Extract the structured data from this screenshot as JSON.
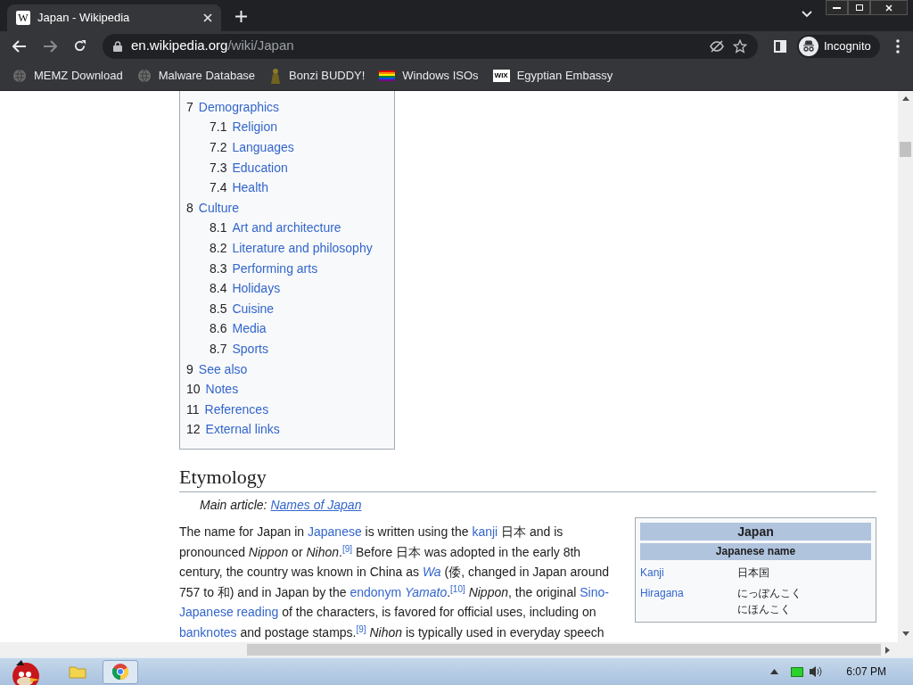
{
  "tab": {
    "favicon": "W",
    "title": "Japan - Wikipedia"
  },
  "address": {
    "host": "en.wikipedia.org",
    "path": "/wiki/Japan"
  },
  "profile": {
    "label": "Incognito"
  },
  "bookmarks": [
    {
      "kind": "globe",
      "label": "MEMZ Download"
    },
    {
      "kind": "globe",
      "label": "Malware Database"
    },
    {
      "kind": "figure",
      "label": "Bonzi BUDDY!"
    },
    {
      "kind": "flag",
      "label": "Windows ISOs"
    },
    {
      "kind": "wix",
      "icon_text": "WIX",
      "label": "Egyptian Embassy"
    }
  ],
  "toc": [
    {
      "number": "7",
      "label": "Demographics",
      "children": [
        {
          "number": "7.1",
          "label": "Religion"
        },
        {
          "number": "7.2",
          "label": "Languages"
        },
        {
          "number": "7.3",
          "label": "Education"
        },
        {
          "number": "7.4",
          "label": "Health"
        }
      ]
    },
    {
      "number": "8",
      "label": "Culture",
      "children": [
        {
          "number": "8.1",
          "label": "Art and architecture"
        },
        {
          "number": "8.2",
          "label": "Literature and philosophy"
        },
        {
          "number": "8.3",
          "label": "Performing arts"
        },
        {
          "number": "8.4",
          "label": "Holidays"
        },
        {
          "number": "8.5",
          "label": "Cuisine"
        },
        {
          "number": "8.6",
          "label": "Media"
        },
        {
          "number": "8.7",
          "label": "Sports"
        }
      ]
    },
    {
      "number": "9",
      "label": "See also"
    },
    {
      "number": "10",
      "label": "Notes"
    },
    {
      "number": "11",
      "label": "References"
    },
    {
      "number": "12",
      "label": "External links"
    }
  ],
  "article": {
    "heading": "Etymology",
    "hatnote": {
      "prefix": "Main article:",
      "link": "Names of Japan"
    },
    "lines": [
      [
        {
          "kind": "text",
          "text": "The name for Japan in "
        },
        {
          "kind": "link",
          "text": "Japanese"
        },
        {
          "kind": "text",
          "text": " is written using the "
        },
        {
          "kind": "link",
          "text": "kanji"
        },
        {
          "kind": "text",
          "text": " 日本 and is"
        }
      ],
      [
        {
          "kind": "text",
          "text": "pronounced "
        },
        {
          "kind": "italic",
          "text": "Nippon"
        },
        {
          "kind": "text",
          "text": " or "
        },
        {
          "kind": "italic",
          "text": "Nihon"
        },
        {
          "kind": "text",
          "text": "."
        },
        {
          "kind": "ref",
          "text": "[9]"
        },
        {
          "kind": "text",
          "text": " Before 日本 was adopted in the early 8th"
        }
      ],
      [
        {
          "kind": "text",
          "text": "century, the country was known in China as "
        },
        {
          "kind": "italic_link",
          "text": "Wa"
        },
        {
          "kind": "text",
          "text": " (倭, changed in Japan around"
        }
      ],
      [
        {
          "kind": "text",
          "text": "757 to 和) and in Japan by the "
        },
        {
          "kind": "link",
          "text": "endonym"
        },
        {
          "kind": "space"
        },
        {
          "kind": "italic_link",
          "text": "Yamato"
        },
        {
          "kind": "text",
          "text": "."
        },
        {
          "kind": "ref",
          "text": "[10]"
        },
        {
          "kind": "space"
        },
        {
          "kind": "italic",
          "text": "Nippon"
        },
        {
          "kind": "text",
          "text": ", the original "
        },
        {
          "kind": "link",
          "text": "Sino-"
        }
      ],
      [
        {
          "kind": "link",
          "text": "Japanese reading"
        },
        {
          "kind": "text",
          "text": " of the characters, is favored for official uses, including on"
        }
      ],
      [
        {
          "kind": "link",
          "text": "banknotes"
        },
        {
          "kind": "text",
          "text": " and postage stamps."
        },
        {
          "kind": "ref",
          "text": "[9]"
        },
        {
          "kind": "space"
        },
        {
          "kind": "italic",
          "text": "Nihon"
        },
        {
          "kind": "text",
          "text": " is typically used in everyday speech"
        }
      ]
    ]
  },
  "infobox": {
    "title": "Japan",
    "subtitle": "Japanese name",
    "rows": [
      {
        "label": "Kanji",
        "values": [
          "日本国"
        ]
      },
      {
        "label": "Hiragana",
        "values": [
          "にっぽんこく",
          "にほんこく"
        ]
      }
    ]
  },
  "taskbar": {
    "clock": "6:07 PM"
  }
}
